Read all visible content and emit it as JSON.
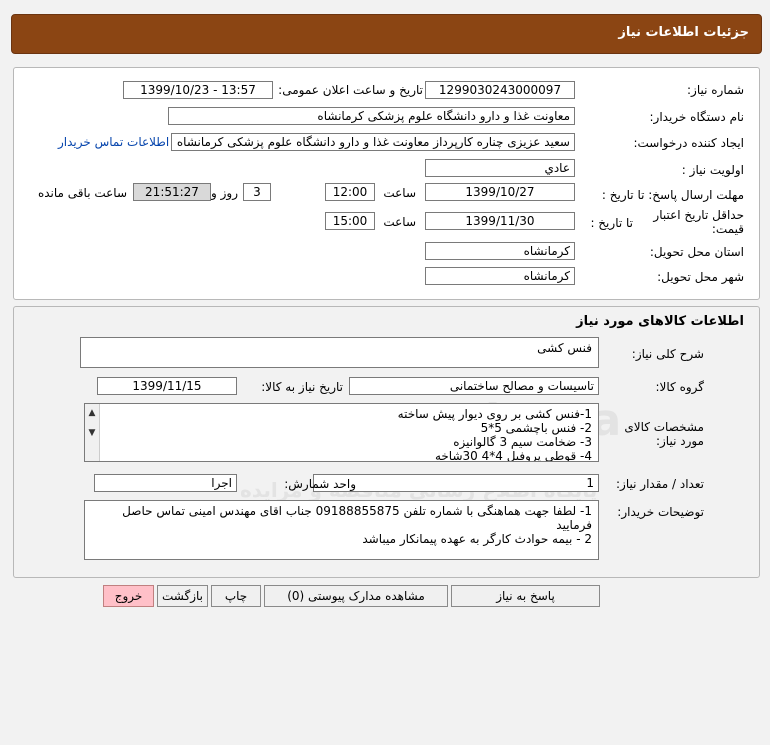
{
  "header": {
    "title": "جزئیات اطلاعات نیاز"
  },
  "info": {
    "need_number_label": "شماره نیاز:",
    "need_number": "1299030243000097",
    "announce_label": "تاریخ و ساعت اعلان عمومی:",
    "announce_value": "1399/10/23 - 13:57",
    "buyer_org_label": "نام دستگاه خریدار:",
    "buyer_org": "معاونت غذا و دارو دانشگاه علوم پزشکی کرمانشاه",
    "creator_label": "ایجاد کننده درخواست:",
    "creator": "سعید عزیزی چناره کارپرداز معاونت غذا و دارو دانشگاه علوم پزشکی کرمانشاه",
    "contact_link": "اطلاعات تماس خریدار",
    "priority_label": "اولویت نیاز :",
    "priority": "عادي",
    "deadline_label": "مهلت ارسال پاسخ: تا تاریخ :",
    "deadline_date": "1399/10/27",
    "time_label": "ساعت",
    "deadline_time": "12:00",
    "days_value": "3",
    "days_label": "روز و",
    "remaining_time": "21:51:27",
    "remaining_label": "ساعت باقی مانده",
    "validity_label": "حداقل تاریخ اعتبار قیمت:",
    "validity_to_label": "تا تاریخ :",
    "validity_date": "1399/11/30",
    "validity_time": "15:00",
    "province_label": "استان محل تحویل:",
    "province": "کرمانشاه",
    "city_label": "شهر محل تحویل:",
    "city": "کرمانشاه"
  },
  "goods": {
    "section_title": "اطلاعات کالاهای مورد نیاز",
    "summary_label": "شرح کلی نیاز:",
    "summary": "فنس کشی",
    "group_label": "گروه کالا:",
    "group": "تاسیسات و مصالح ساختمانی",
    "need_date_label": "تاریخ نیاز به کالا:",
    "need_date": "1399/11/15",
    "specs_label": "مشخصات کالای مورد نیاز:",
    "specs": [
      "1-فنس کشی بر روی دیوار پیش ساخته",
      "2- فنس باچشمی 5*5",
      "3- ضخامت سیم 3 گالوانیزه",
      "4- قوطی پروفیل 4*4 30شاخه"
    ],
    "qty_label": "تعداد / مقدار نیاز:",
    "qty": "1",
    "unit_label": "واحد شمارش:",
    "unit": "اجرا",
    "notes_label": "توضیحات خریدار:",
    "notes": [
      "1- لطفا جهت هماهنگی با شماره تلفن 09188855875 جناب اقای مهندس امینی تماس حاصل فرمایید",
      "2 - بیمه حوادث کارگر به عهده پیمانکار میباشد"
    ]
  },
  "buttons": {
    "reply": "پاسخ به نیاز",
    "attachments": "مشاهده مدارک پیوستی (0)",
    "print": "چاپ",
    "back": "بازگشت",
    "exit": "خروج"
  },
  "watermark": {
    "brand": "ParsNamadData",
    "brand_fa": "پارس نماد داده ها",
    "line1": "پایگاه اطلاع رسانی مناقصه و مزایده",
    "phone": "۰۲۱-۸۸۳۴۹۶۷۰"
  },
  "colors": {
    "header": "#8b4513",
    "exit_button": "#ffc0c8"
  }
}
